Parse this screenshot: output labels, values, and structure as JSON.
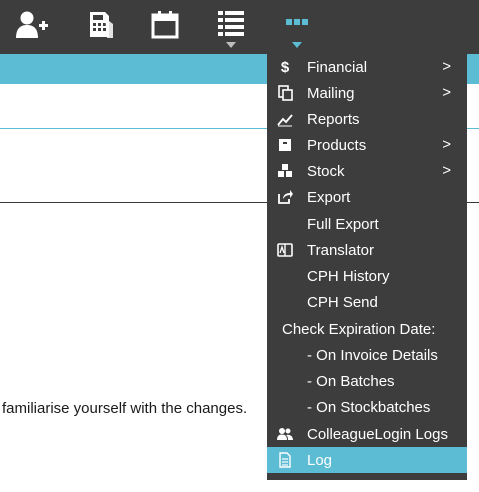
{
  "toolbar": {
    "icons": [
      "add-user-icon",
      "calculator-icon",
      "calendar-icon",
      "list-icon",
      "more-icon"
    ]
  },
  "content": {
    "notice": "familiarise yourself with the changes."
  },
  "menu": {
    "financial": "Financial",
    "mailing": "Mailing",
    "reports": "Reports",
    "products": "Products",
    "stock": "Stock",
    "export": "Export",
    "full_export": "Full Export",
    "translator": "Translator",
    "cph_history": "CPH History",
    "cph_send": "CPH Send",
    "check_expiration_header": "Check Expiration Date:",
    "on_invoice_details": "- On Invoice Details",
    "on_batches": "- On Batches",
    "on_stockbatches": "- On Stockbatches",
    "colleague_login_logs": "ColleagueLogin Logs",
    "log": "Log",
    "chevron": ">",
    "dollar": "$"
  },
  "colors": {
    "toolbar_bg": "#3d3d3d",
    "accent": "#5bbcd4",
    "menu_text": "#ffffff"
  }
}
